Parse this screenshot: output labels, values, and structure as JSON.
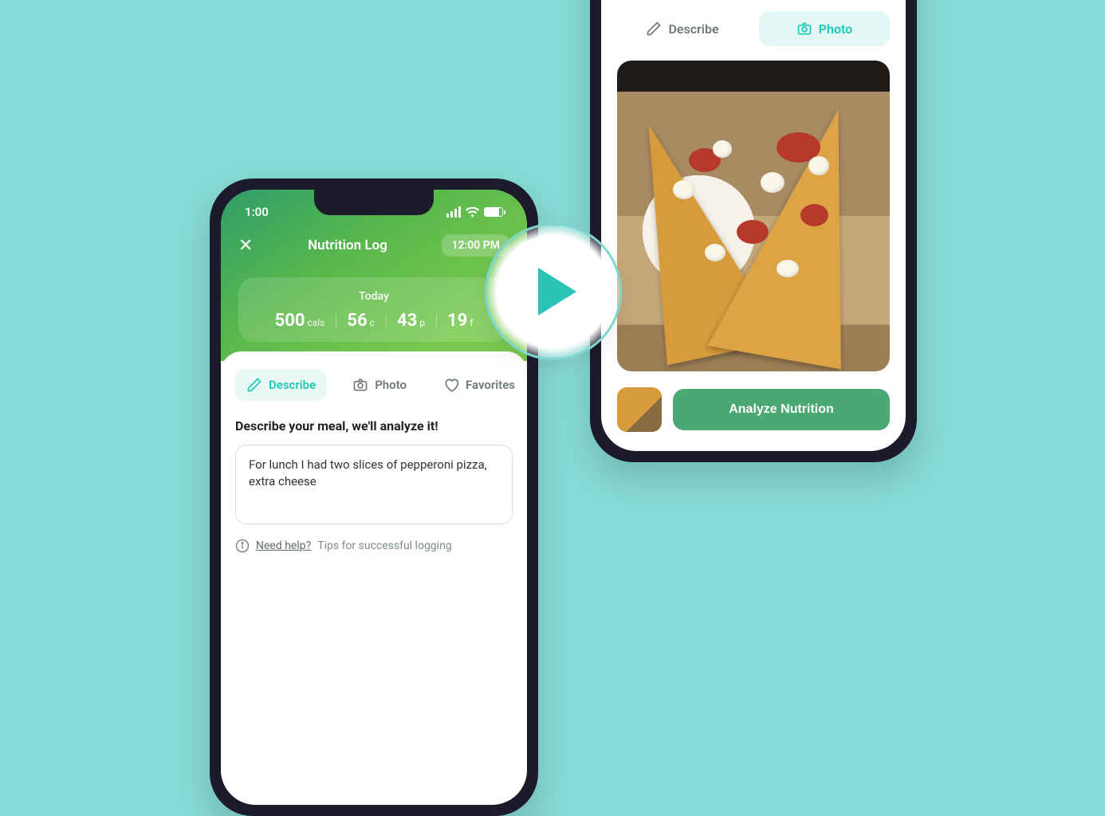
{
  "phoneLeft": {
    "statusTime": "1:00",
    "pageTitle": "Nutrition Log",
    "logTime": "12:00 PM",
    "summaryLabel": "Today",
    "metrics": {
      "cals": {
        "value": "500",
        "unit": "cals"
      },
      "carbs": {
        "value": "56",
        "unit": "c"
      },
      "protein": {
        "value": "43",
        "unit": "p"
      },
      "fat": {
        "value": "19",
        "unit": "f"
      }
    },
    "tabs": {
      "describe": "Describe",
      "photo": "Photo",
      "favorites": "Favorites"
    },
    "prompt": "Describe your meal, we'll analyze it!",
    "mealText": "For lunch I had two slices of pepperoni pizza, extra cheese",
    "helpLink": "Need help?",
    "helpTail": "Tips for successful logging"
  },
  "phoneRight": {
    "tabs": {
      "describe": "Describe",
      "photo": "Photo"
    },
    "analyzeLabel": "Analyze Nutrition"
  }
}
